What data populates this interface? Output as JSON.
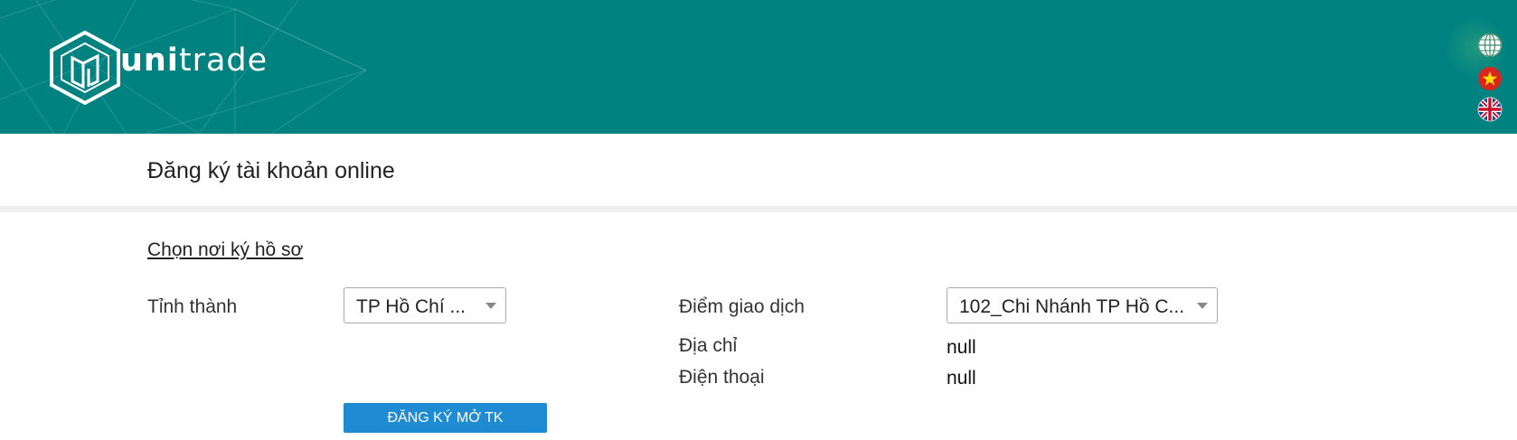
{
  "header": {
    "brand_bold": "uni",
    "brand_light": "trade",
    "background_color": "#008281",
    "languages": [
      {
        "name": "globe-icon"
      },
      {
        "name": "vietnam-flag-icon"
      },
      {
        "name": "uk-flag-icon"
      }
    ]
  },
  "page": {
    "title": "Đăng ký tài khoản online"
  },
  "form": {
    "section_title": "Chọn nơi ký hồ sơ",
    "province_label": "Tỉnh thành",
    "province_value": "TP Hồ Chí ...",
    "branch_label": "Điểm giao dịch",
    "branch_value": "102_Chi Nhánh TP Hồ C...",
    "address_label": "Địa chỉ",
    "address_value": "null",
    "phone_label": "Điện thoại",
    "phone_value": "null",
    "submit_label": "ĐĂNG KÝ MỞ TK",
    "submit_color": "#1f8bd2"
  }
}
